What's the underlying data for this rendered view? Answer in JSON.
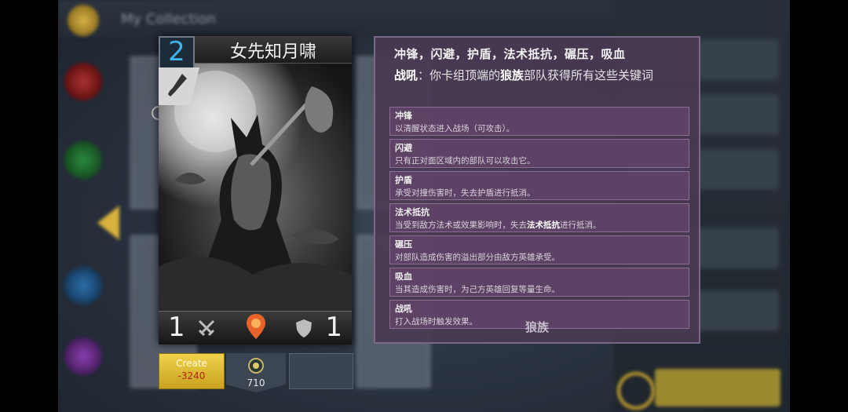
{
  "background": {
    "title": "My Collection"
  },
  "card": {
    "name": "女先知月啸",
    "cost": "2",
    "attack": "1",
    "health": "1",
    "type_icon": "sword-icon",
    "faction_icon": "map-pin-icon"
  },
  "actions": {
    "create_label": "Create",
    "create_cost": "-3240",
    "dust_count": "710"
  },
  "panel": {
    "keywords_line": "冲锋，闪避，护盾，法术抵抗，碾压，吸血",
    "desc_prefix": "战吼",
    "desc_middle": "：你卡组顶端的",
    "desc_bold": "狼族",
    "desc_suffix": "部队获得所有这些关键词",
    "keywords": [
      {
        "title": "冲锋",
        "text": "以清醒状态进入战场（可攻击）。"
      },
      {
        "title": "闪避",
        "text": "只有正对面区域内的部队可以攻击它。"
      },
      {
        "title": "护盾",
        "text": "承受对撞伤害时，失去护盾进行抵消。"
      },
      {
        "title": "法术抵抗",
        "text_pre": "当受到敌方法术或效果影响时，失去",
        "text_bold": "法术抵抗",
        "text_post": "进行抵消。"
      },
      {
        "title": "碾压",
        "text": "对部队造成伤害的溢出部分由敌方英雄承受。"
      },
      {
        "title": "吸血",
        "text": "当其造成伤害时，为己方英雄回复等量生命。"
      },
      {
        "title": "战吼",
        "text": "打入战场时触发效果。"
      }
    ],
    "footer": "狼族"
  },
  "colors": {
    "cost": "#3fb2e6",
    "create_button": "#e2c134",
    "create_cost": "#b0240e",
    "panel_bg": "#4a3a54"
  }
}
